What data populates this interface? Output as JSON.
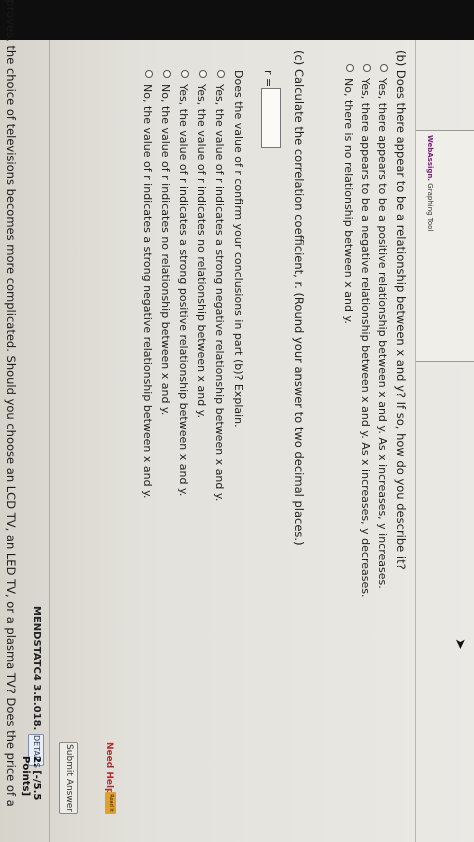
{
  "graph_tool": {
    "brand": "WebAssign.",
    "label": "Graphing Tool"
  },
  "part_b": {
    "question": "(b)  Does there appear to be a relationship between x and y? If so, how do you describe it?",
    "options": [
      "Yes, there appears to be a positive relationship between x and y. As x increases, y increases.",
      "Yes, there appears to be a negative relationship between x and y. As x increases, y decreases.",
      "No, there is no relationship between x and y."
    ]
  },
  "part_c": {
    "question": "(c)  Calculate the correlation coefficient, r. (Round your answer to two decimal places.)",
    "r_label": "r =",
    "r_value": "",
    "followup": "Does the value of r confirm your conclusions in part (b)? Explain.",
    "options": [
      "Yes, the value of r indicates a strong negative relationship between x and y.",
      "Yes, the value of r indicates no relationship between x and y.",
      "Yes, the value of r indicates a strong positive relationship between x and y.",
      "No, the value of r indicates no relationship between x and y.",
      "No, the value of r indicates a strong negative relationship between x and y."
    ]
  },
  "help": {
    "need_help": "Need Help?",
    "read_it": "Read It"
  },
  "submit_label": "Submit Answer",
  "next_question": {
    "points": "2.  [-/5.5 Points]",
    "details": "DETAILS",
    "code": "MENDSTATC4 3.E.018.",
    "text": "As technology improves, the choice of televisions becomes more complicated. Should you choose an LCD TV, an LED TV, or a plasma TV? Does the price of a"
  }
}
